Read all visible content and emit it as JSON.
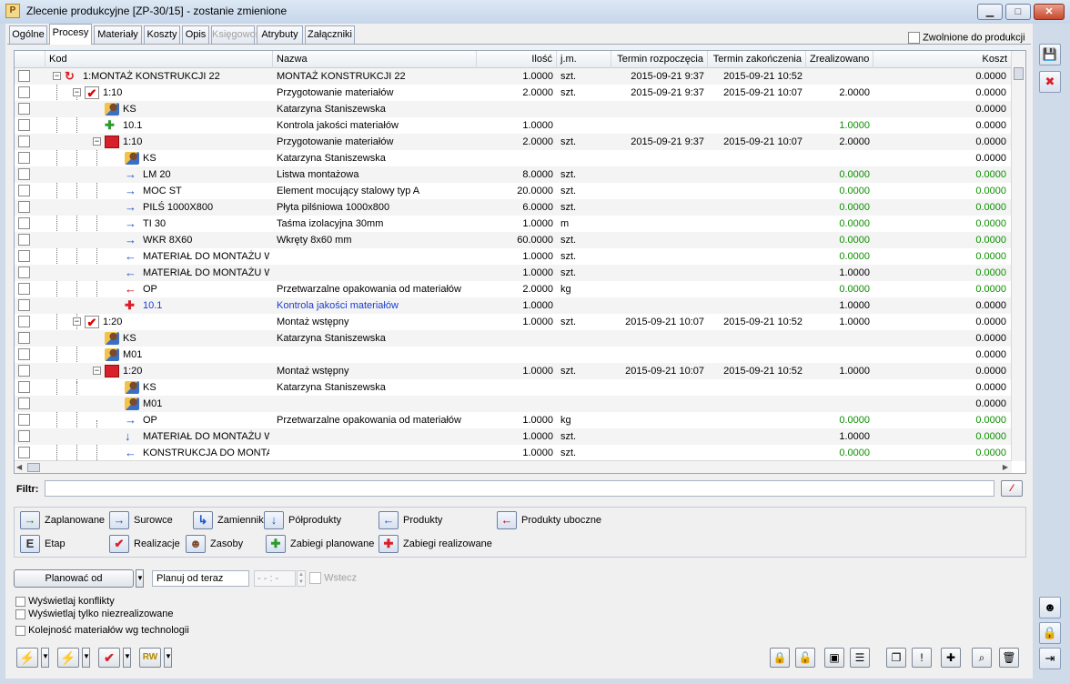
{
  "window": {
    "title": "Zlecenie produkcyjne  [ZP-30/15] - zostanie zmienione",
    "app_icon": "P",
    "buttons": [
      "minimize",
      "maximize",
      "close"
    ]
  },
  "tabs": [
    {
      "label": "Ogólne",
      "active": false,
      "disabled": false
    },
    {
      "label": "Procesy",
      "active": true,
      "disabled": false
    },
    {
      "label": "Materiały",
      "active": false,
      "disabled": false
    },
    {
      "label": "Koszty",
      "active": false,
      "disabled": false
    },
    {
      "label": "Opis",
      "active": false,
      "disabled": false
    },
    {
      "label": "Księgowość",
      "active": false,
      "disabled": true
    },
    {
      "label": "Atrybuty",
      "active": false,
      "disabled": false
    },
    {
      "label": "Załączniki",
      "active": false,
      "disabled": false
    }
  ],
  "released_checkbox_label": "Zwolnione do produkcji",
  "grid": {
    "columns": [
      "Kod",
      "Nazwa",
      "Ilość",
      "j.m.",
      "Termin rozpoczęcia",
      "Termin zakończenia",
      "Zrealizowano",
      "Koszt"
    ],
    "rows": [
      {
        "level": 0,
        "icon": "cycle-icon",
        "expander": "−",
        "kod": "1:MONTAŻ KONSTRUKCJI 22",
        "nazwa": "MONTAŻ KONSTRUKCJI 22",
        "ilosc": "1.0000",
        "jm": "szt.",
        "start": "2015-09-21 9:37",
        "end": "2015-09-21 10:52",
        "zreal": "",
        "koszt": "0.0000",
        "style": ""
      },
      {
        "level": 1,
        "icon": "realization-check-icon",
        "expander": "−",
        "kod": "1:10",
        "nazwa": "Przygotowanie materiałów",
        "ilosc": "2.0000",
        "jm": "szt.",
        "start": "2015-09-21 9:37",
        "end": "2015-09-21 10:07",
        "zreal": "2.0000",
        "koszt": "0.0000",
        "style": ""
      },
      {
        "level": 2,
        "icon": "resource-person-icon",
        "expander": "",
        "kod": "KS",
        "nazwa": "Katarzyna Staniszewska",
        "ilosc": "",
        "jm": "",
        "start": "",
        "end": "",
        "zreal": "",
        "koszt": "0.0000",
        "style": ""
      },
      {
        "level": 2,
        "icon": "planned-operation-icon",
        "expander": "",
        "kod": "10.1",
        "nazwa": "Kontrola jakości materiałów",
        "ilosc": "1.0000",
        "jm": "",
        "start": "",
        "end": "",
        "zreal": "1.0000",
        "koszt": "0.0000",
        "style": "green-zreal"
      },
      {
        "level": 2,
        "icon": "realization-red-icon",
        "expander": "−",
        "kod": "1:10",
        "nazwa": "Przygotowanie materiałów",
        "ilosc": "2.0000",
        "jm": "szt.",
        "start": "2015-09-21 9:37",
        "end": "2015-09-21 10:07",
        "zreal": "2.0000",
        "koszt": "0.0000",
        "style": ""
      },
      {
        "level": 3,
        "icon": "resource-person-icon",
        "expander": "",
        "kod": "KS",
        "nazwa": "Katarzyna Staniszewska",
        "ilosc": "",
        "jm": "",
        "start": "",
        "end": "",
        "zreal": "",
        "koszt": "0.0000",
        "style": ""
      },
      {
        "level": 3,
        "icon": "raw-material-arrow-icon",
        "expander": "",
        "kod": "LM 20",
        "nazwa": "Listwa montażowa",
        "ilosc": "8.0000",
        "jm": "szt.",
        "start": "",
        "end": "",
        "zreal": "0.0000",
        "koszt": "0.0000",
        "style": "green"
      },
      {
        "level": 3,
        "icon": "raw-material-arrow-icon",
        "expander": "",
        "kod": "MOC ST",
        "nazwa": "Element mocujący stalowy typ A",
        "ilosc": "20.0000",
        "jm": "szt.",
        "start": "",
        "end": "",
        "zreal": "0.0000",
        "koszt": "0.0000",
        "style": "green"
      },
      {
        "level": 3,
        "icon": "raw-material-arrow-icon",
        "expander": "",
        "kod": "PILŚ 1000X800",
        "nazwa": "Płyta pilśniowa 1000x800",
        "ilosc": "6.0000",
        "jm": "szt.",
        "start": "",
        "end": "",
        "zreal": "0.0000",
        "koszt": "0.0000",
        "style": "green"
      },
      {
        "level": 3,
        "icon": "raw-material-arrow-icon",
        "expander": "",
        "kod": "TI 30",
        "nazwa": "Taśma izolacyjna 30mm",
        "ilosc": "1.0000",
        "jm": "m",
        "start": "",
        "end": "",
        "zreal": "0.0000",
        "koszt": "0.0000",
        "style": "green"
      },
      {
        "level": 3,
        "icon": "raw-material-arrow-icon",
        "expander": "",
        "kod": "WKR 8X60",
        "nazwa": "Wkręty 8x60 mm",
        "ilosc": "60.0000",
        "jm": "szt.",
        "start": "",
        "end": "",
        "zreal": "0.0000",
        "koszt": "0.0000",
        "style": "green"
      },
      {
        "level": 3,
        "icon": "product-arrow-icon",
        "expander": "",
        "kod": "MATERIAŁ DO MONTAŻU WS",
        "nazwa": "",
        "ilosc": "1.0000",
        "jm": "szt.",
        "start": "",
        "end": "",
        "zreal": "0.0000",
        "koszt": "0.0000",
        "style": "green"
      },
      {
        "level": 3,
        "icon": "product-arrow-icon",
        "expander": "",
        "kod": "MATERIAŁ DO MONTAŻU WS",
        "nazwa": "",
        "ilosc": "1.0000",
        "jm": "szt.",
        "start": "",
        "end": "",
        "zreal": "1.0000",
        "koszt": "0.0000",
        "style": "green-koszt"
      },
      {
        "level": 3,
        "icon": "byproduct-arrow-icon",
        "expander": "",
        "kod": "OP",
        "nazwa": "Przetwarzalne opakowania od materiałów",
        "ilosc": "2.0000",
        "jm": "kg",
        "start": "",
        "end": "",
        "zreal": "0.0000",
        "koszt": "0.0000",
        "style": "green"
      },
      {
        "level": 3,
        "icon": "realized-operation-icon",
        "expander": "",
        "kod": "10.1",
        "nazwa": "Kontrola jakości materiałów",
        "ilosc": "1.0000",
        "jm": "",
        "start": "",
        "end": "",
        "zreal": "1.0000",
        "koszt": "0.0000",
        "style": "blue"
      },
      {
        "level": 1,
        "icon": "realization-check-icon",
        "expander": "−",
        "kod": "1:20",
        "nazwa": "Montaż wstępny",
        "ilosc": "1.0000",
        "jm": "szt.",
        "start": "2015-09-21 10:07",
        "end": "2015-09-21 10:52",
        "zreal": "1.0000",
        "koszt": "0.0000",
        "style": ""
      },
      {
        "level": 2,
        "icon": "resource-person-icon",
        "expander": "",
        "kod": "KS",
        "nazwa": "Katarzyna Staniszewska",
        "ilosc": "",
        "jm": "",
        "start": "",
        "end": "",
        "zreal": "",
        "koszt": "0.0000",
        "style": ""
      },
      {
        "level": 2,
        "icon": "resource-person-icon",
        "expander": "",
        "kod": "M01",
        "nazwa": "",
        "ilosc": "",
        "jm": "",
        "start": "",
        "end": "",
        "zreal": "",
        "koszt": "0.0000",
        "style": ""
      },
      {
        "level": 2,
        "icon": "realization-red-icon",
        "expander": "−",
        "kod": "1:20",
        "nazwa": "Montaż wstępny",
        "ilosc": "1.0000",
        "jm": "szt.",
        "start": "2015-09-21 10:07",
        "end": "2015-09-21 10:52",
        "zreal": "1.0000",
        "koszt": "0.0000",
        "style": ""
      },
      {
        "level": 3,
        "icon": "resource-person-icon",
        "expander": "",
        "kod": "KS",
        "nazwa": "Katarzyna Staniszewska",
        "ilosc": "",
        "jm": "",
        "start": "",
        "end": "",
        "zreal": "",
        "koszt": "0.0000",
        "style": ""
      },
      {
        "level": 3,
        "icon": "resource-person-icon",
        "expander": "",
        "kod": "M01",
        "nazwa": "",
        "ilosc": "",
        "jm": "",
        "start": "",
        "end": "",
        "zreal": "",
        "koszt": "0.0000",
        "style": ""
      },
      {
        "level": 3,
        "icon": "raw-material-arrow-icon",
        "expander": "",
        "kod": "OP",
        "nazwa": "Przetwarzalne opakowania od materiałów",
        "ilosc": "1.0000",
        "jm": "kg",
        "start": "",
        "end": "",
        "zreal": "0.0000",
        "koszt": "0.0000",
        "style": "green"
      },
      {
        "level": 3,
        "icon": "semiproduct-arrow-icon",
        "expander": "",
        "kod": "MATERIAŁ DO MONTAŻU WS",
        "nazwa": "",
        "ilosc": "1.0000",
        "jm": "szt.",
        "start": "",
        "end": "",
        "zreal": "1.0000",
        "koszt": "0.0000",
        "style": "green-koszt"
      },
      {
        "level": 3,
        "icon": "product-arrow-icon",
        "expander": "",
        "kod": "KONSTRUKCJA DO MONTAŻ",
        "nazwa": "",
        "ilosc": "1.0000",
        "jm": "szt.",
        "start": "",
        "end": "",
        "zreal": "0.0000",
        "koszt": "0.0000",
        "style": "green"
      }
    ]
  },
  "filter": {
    "label": "Filtr:",
    "value": ""
  },
  "legend": [
    {
      "label": "Zaplanowane",
      "icon": "planned-arrow-icon",
      "glyph": "→",
      "color": "#1d8a1d"
    },
    {
      "label": "Surowce",
      "icon": "raw-material-icon",
      "glyph": "→",
      "color": "#1a56c9"
    },
    {
      "label": "Zamienniki",
      "icon": "substitute-icon",
      "glyph": "↳",
      "color": "#1a56c9"
    },
    {
      "label": "Półprodukty",
      "icon": "semiproduct-icon",
      "glyph": "↓",
      "color": "#1a56c9"
    },
    {
      "label": "Produkty",
      "icon": "product-icon",
      "glyph": "←",
      "color": "#1a56c9"
    },
    {
      "label": "Produkty uboczne",
      "icon": "byproduct-icon",
      "glyph": "←",
      "color": "#c00000"
    },
    {
      "label": "Etap",
      "icon": "stage-icon",
      "glyph": "E",
      "color": "#333333"
    },
    {
      "label": "Realizacje",
      "icon": "realization-icon",
      "glyph": "✔",
      "color": "#d8202a"
    },
    {
      "label": "Zasoby",
      "icon": "resources-icon",
      "glyph": "☻",
      "color": "#7a4a2a"
    },
    {
      "label": "Zabiegi planowane",
      "icon": "planned-operations-icon",
      "glyph": "✚",
      "color": "#2e9a2e"
    },
    {
      "label": "Zabiegi realizowane",
      "icon": "realized-operations-icon",
      "glyph": "✚",
      "color": "#d8202a"
    }
  ],
  "planning": {
    "button_label": "Planować od",
    "field_value": "Planuj od teraz",
    "time_placeholder": "- - : -",
    "backwards_label": "Wstecz"
  },
  "options": [
    "Wyświetlaj konflikty",
    "Wyświetlaj tylko niezrealizowane",
    "Kolejność materiałów wg technologii"
  ],
  "bottom_left_buttons": [
    {
      "name": "lightning-orange-icon",
      "glyph": "⚡",
      "color": "#e08a00"
    },
    {
      "name": "lightning-green-icon",
      "glyph": "⚡",
      "color": "#2e9a2e"
    },
    {
      "name": "realization-button-icon",
      "glyph": "✔",
      "color": "#d8202a"
    },
    {
      "name": "rw-icon",
      "glyph": "RW",
      "color": "#b08a00"
    }
  ],
  "bottom_right_buttons": [
    {
      "name": "lock-green-icon",
      "glyph": "🔒"
    },
    {
      "name": "unlock-green-icon",
      "glyph": "🔓"
    },
    {
      "name": "export-icon",
      "glyph": "▣"
    },
    {
      "name": "gantt-icon",
      "glyph": "☰"
    },
    {
      "name": "copy-icon",
      "glyph": "❐"
    },
    {
      "name": "conflict-icon",
      "glyph": "!"
    },
    {
      "name": "add-icon",
      "glyph": "✚"
    },
    {
      "name": "search-icon",
      "glyph": "⌕"
    },
    {
      "name": "delete-icon",
      "glyph": "🗑"
    }
  ],
  "sidebar_buttons": [
    {
      "name": "save-icon",
      "glyph": "💾"
    },
    {
      "name": "cancel-icon",
      "glyph": "✖"
    },
    {
      "name": "resource-assign-icon",
      "glyph": "☻"
    },
    {
      "name": "lock-icon",
      "glyph": "🔒"
    },
    {
      "name": "pin-icon",
      "glyph": "⇥"
    }
  ]
}
